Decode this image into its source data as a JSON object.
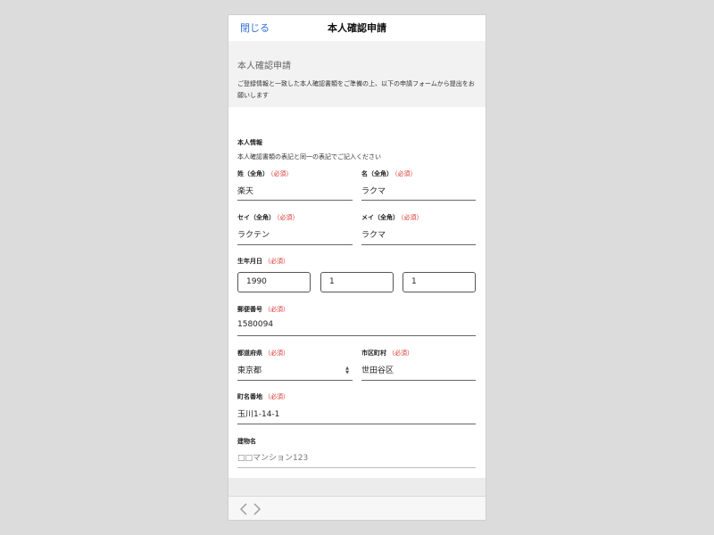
{
  "navbar": {
    "close_label": "閉じる",
    "title": "本人確認申請"
  },
  "intro": {
    "heading": "本人確認申請",
    "text": "ご登録情報と一致した本人確認書類をご準備の上、以下の申請フォームから提出をお願いします"
  },
  "section": {
    "title": "本人情報",
    "description": "本人確認書類の表記と同一の表記でご記入ください"
  },
  "required_label": "（必須）",
  "fields": {
    "last_name": {
      "label": "姓（全角）",
      "value": "楽天"
    },
    "first_name": {
      "label": "名（全角）",
      "value": "ラクマ"
    },
    "last_name_kana": {
      "label": "セイ（全角）",
      "value": "ラクテン"
    },
    "first_name_kana": {
      "label": "メイ（全角）",
      "value": "ラクマ"
    },
    "birthdate": {
      "label": "生年月日",
      "year": "1990",
      "month": "1",
      "day": "1"
    },
    "postal_code": {
      "label": "郵便番号",
      "value": "1580094"
    },
    "prefecture": {
      "label": "都道府県",
      "value": "東京都"
    },
    "city": {
      "label": "市区町村",
      "value": "世田谷区"
    },
    "street": {
      "label": "町名番地",
      "value": "玉川1-14-1"
    },
    "building": {
      "label": "建物名",
      "placeholder": "□□マンション123"
    }
  },
  "toolbar": {
    "back_icon": "chevron-left-icon",
    "forward_icon": "chevron-right-icon"
  },
  "colors": {
    "link": "#2f6fd6",
    "required": "#d9322b"
  }
}
